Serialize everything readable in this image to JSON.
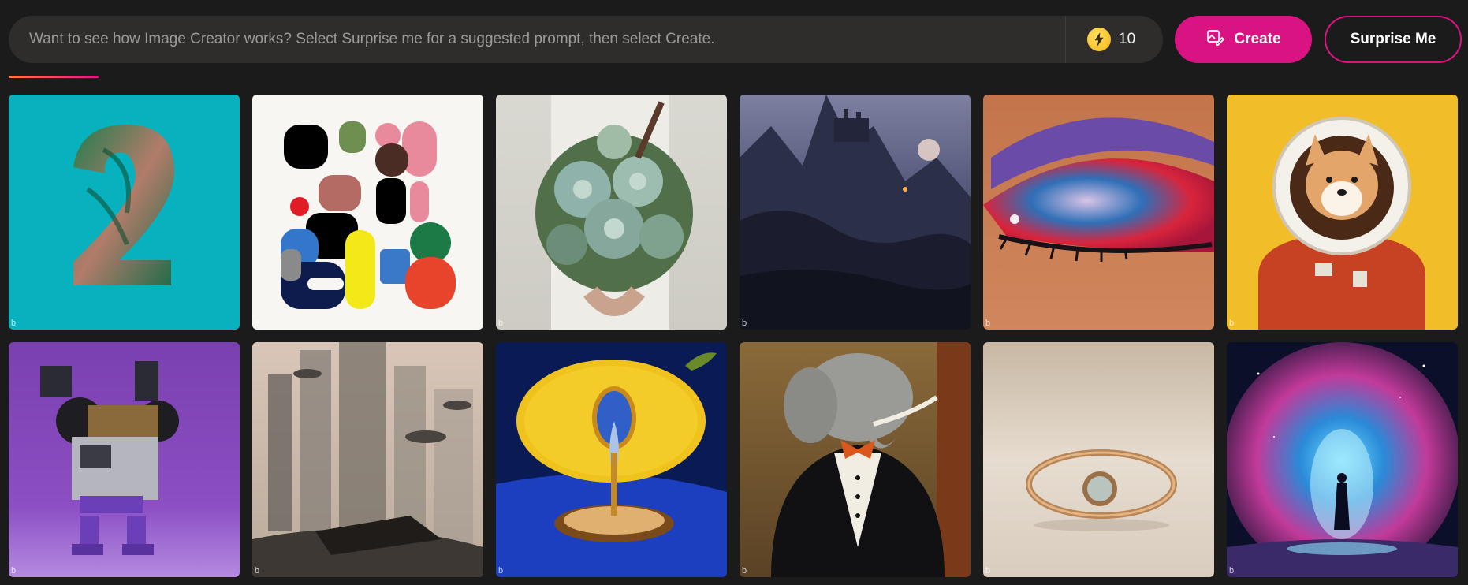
{
  "prompt": {
    "placeholder": "Want to see how Image Creator works? Select Surprise me for a suggested prompt, then select Create.",
    "value": ""
  },
  "boosts": {
    "count": "10",
    "icon": "lightning-bolt-icon"
  },
  "actions": {
    "create_label": "Create",
    "create_icon": "image-edit-icon",
    "surprise_label": "Surprise Me"
  },
  "colors": {
    "accent": "#d91382",
    "background": "#1c1b1b",
    "boost_coin": "#f3b40c"
  },
  "gallery": {
    "badge": "b",
    "tiles": [
      {
        "subject": "number-2-foliage"
      },
      {
        "subject": "abstract-shapes"
      },
      {
        "subject": "succulent-bouquet"
      },
      {
        "subject": "dark-castle-mountains"
      },
      {
        "subject": "eye-makeup"
      },
      {
        "subject": "shiba-astronaut"
      },
      {
        "subject": "robot-toy"
      },
      {
        "subject": "futuristic-city"
      },
      {
        "subject": "lemon-drop"
      },
      {
        "subject": "elephant-tuxedo"
      },
      {
        "subject": "gold-ring"
      },
      {
        "subject": "cosmic-figure"
      }
    ]
  }
}
